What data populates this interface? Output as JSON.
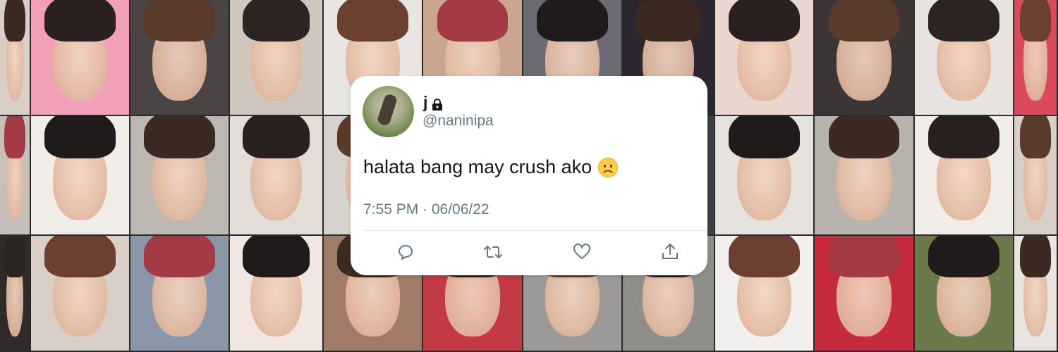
{
  "tweet": {
    "display_name": "j",
    "handle": "@naninipa",
    "text": "halata bang may crush ako",
    "timestamp": "7:55 PM · 06/06/22",
    "lock_icon": "lock-icon",
    "emoji_icon": "worried-face-emoji",
    "actions": [
      {
        "name": "reply-icon"
      },
      {
        "name": "retweet-icon"
      },
      {
        "name": "like-icon"
      },
      {
        "name": "share-icon"
      }
    ]
  },
  "colors": {
    "card_bg": "#ffffff",
    "text_primary": "#14171a",
    "text_secondary": "#657786",
    "icon": "#657786"
  }
}
